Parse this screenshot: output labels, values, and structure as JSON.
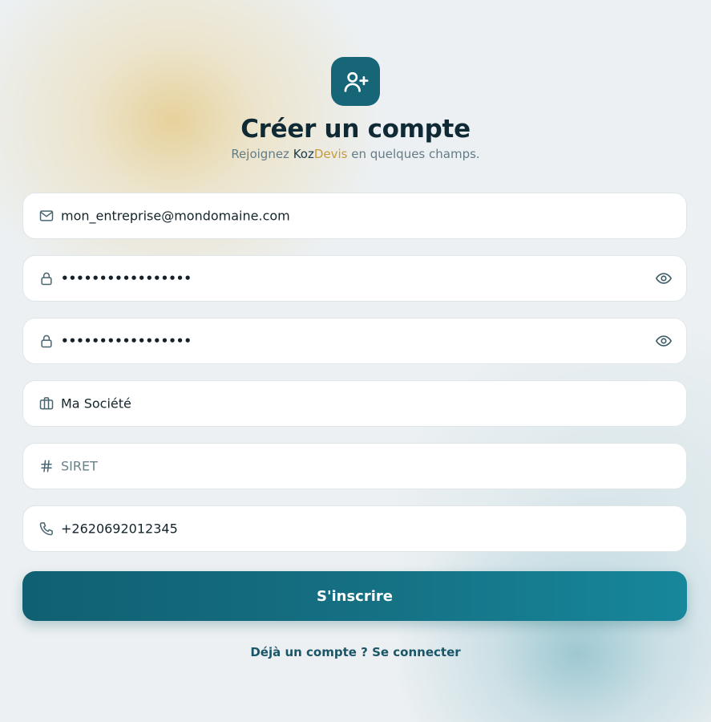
{
  "header": {
    "logo_icon": "user-plus-icon",
    "title": "Créer un compte",
    "subtitle_prefix": "Rejoignez ",
    "brand_part1": "Koz",
    "brand_part2": "Devis",
    "subtitle_suffix": " en quelques champs."
  },
  "form": {
    "email": {
      "icon": "mail-icon",
      "value": "mon_entreprise@mondomaine.com"
    },
    "password": {
      "icon": "lock-icon",
      "value": "•••••••••••••••••",
      "toggle_icon": "eye-icon"
    },
    "password_confirm": {
      "icon": "lock-icon",
      "value": "•••••••••••••••••",
      "toggle_icon": "eye-icon"
    },
    "company": {
      "icon": "briefcase-icon",
      "value": "Ma Société"
    },
    "siret": {
      "icon": "hash-icon",
      "placeholder": "SIRET",
      "value": ""
    },
    "phone": {
      "icon": "phone-icon",
      "value": "+2620692012345"
    },
    "submit_label": "S'inscrire"
  },
  "footer": {
    "login_link": "Déjà un compte ? Se connecter"
  },
  "colors": {
    "accent": "#176678",
    "brand_gold": "#c79a3a",
    "background": "#ecf0f2"
  }
}
